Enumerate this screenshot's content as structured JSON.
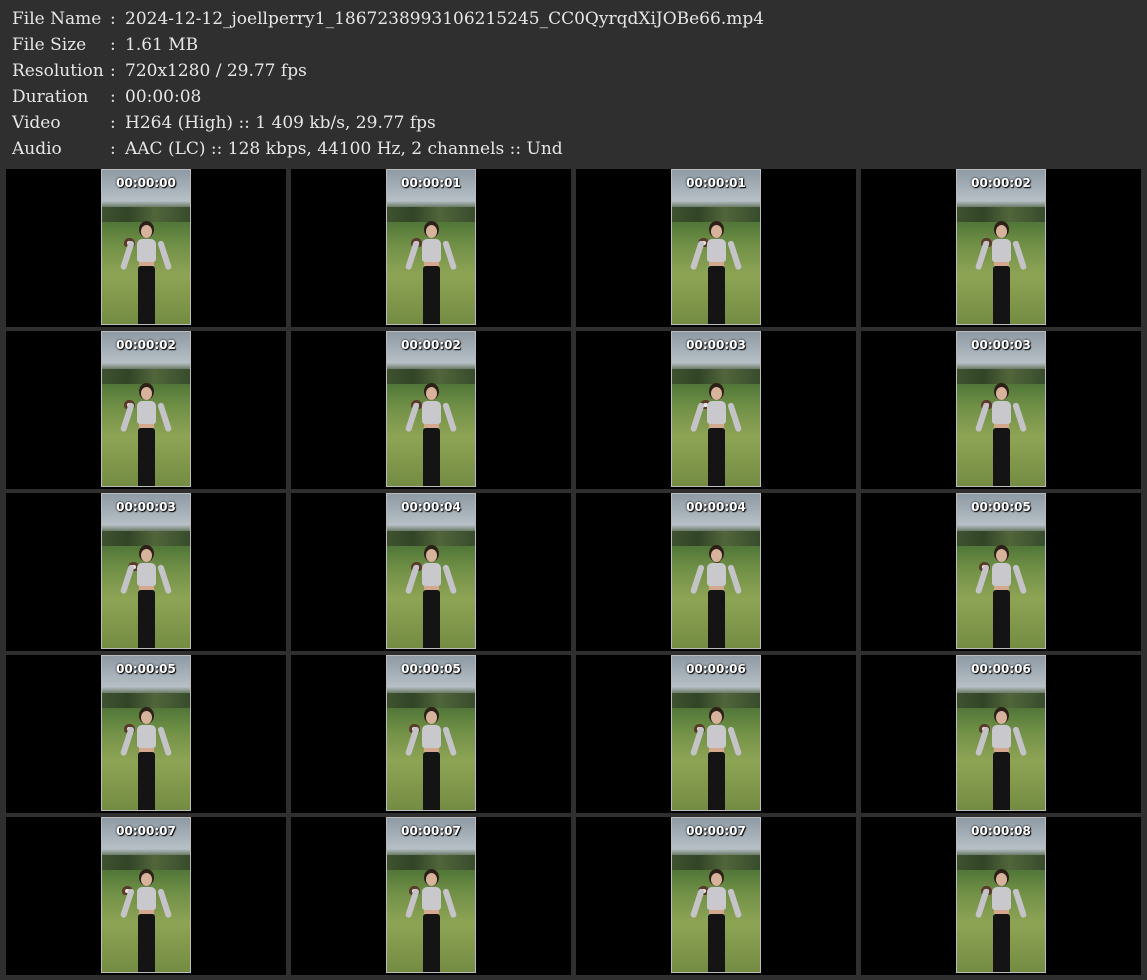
{
  "info": [
    {
      "label": "File Name",
      "value": "2024-12-12_joellperry1_1867238993106215245_CC0QyrqdXiJOBe66.mp4"
    },
    {
      "label": "File Size",
      "value": "1.61 MB"
    },
    {
      "label": "Resolution",
      "value": "720x1280 / 29.77 fps"
    },
    {
      "label": "Duration",
      "value": "00:00:08"
    },
    {
      "label": "Video",
      "value": "H264 (High) :: 1 409 kb/s, 29.77 fps"
    },
    {
      "label": "Audio",
      "value": "AAC (LC) :: 128 kbps, 44100 Hz, 2 channels :: Und"
    }
  ],
  "separator": ":",
  "frames": [
    {
      "time": "00:00:00"
    },
    {
      "time": "00:00:01"
    },
    {
      "time": "00:00:01"
    },
    {
      "time": "00:00:02"
    },
    {
      "time": "00:00:02"
    },
    {
      "time": "00:00:02"
    },
    {
      "time": "00:00:03"
    },
    {
      "time": "00:00:03"
    },
    {
      "time": "00:00:03"
    },
    {
      "time": "00:00:04"
    },
    {
      "time": "00:00:04"
    },
    {
      "time": "00:00:05"
    },
    {
      "time": "00:00:05"
    },
    {
      "time": "00:00:05"
    },
    {
      "time": "00:00:06"
    },
    {
      "time": "00:00:06"
    },
    {
      "time": "00:00:07"
    },
    {
      "time": "00:00:07"
    },
    {
      "time": "00:00:07"
    },
    {
      "time": "00:00:08"
    }
  ]
}
